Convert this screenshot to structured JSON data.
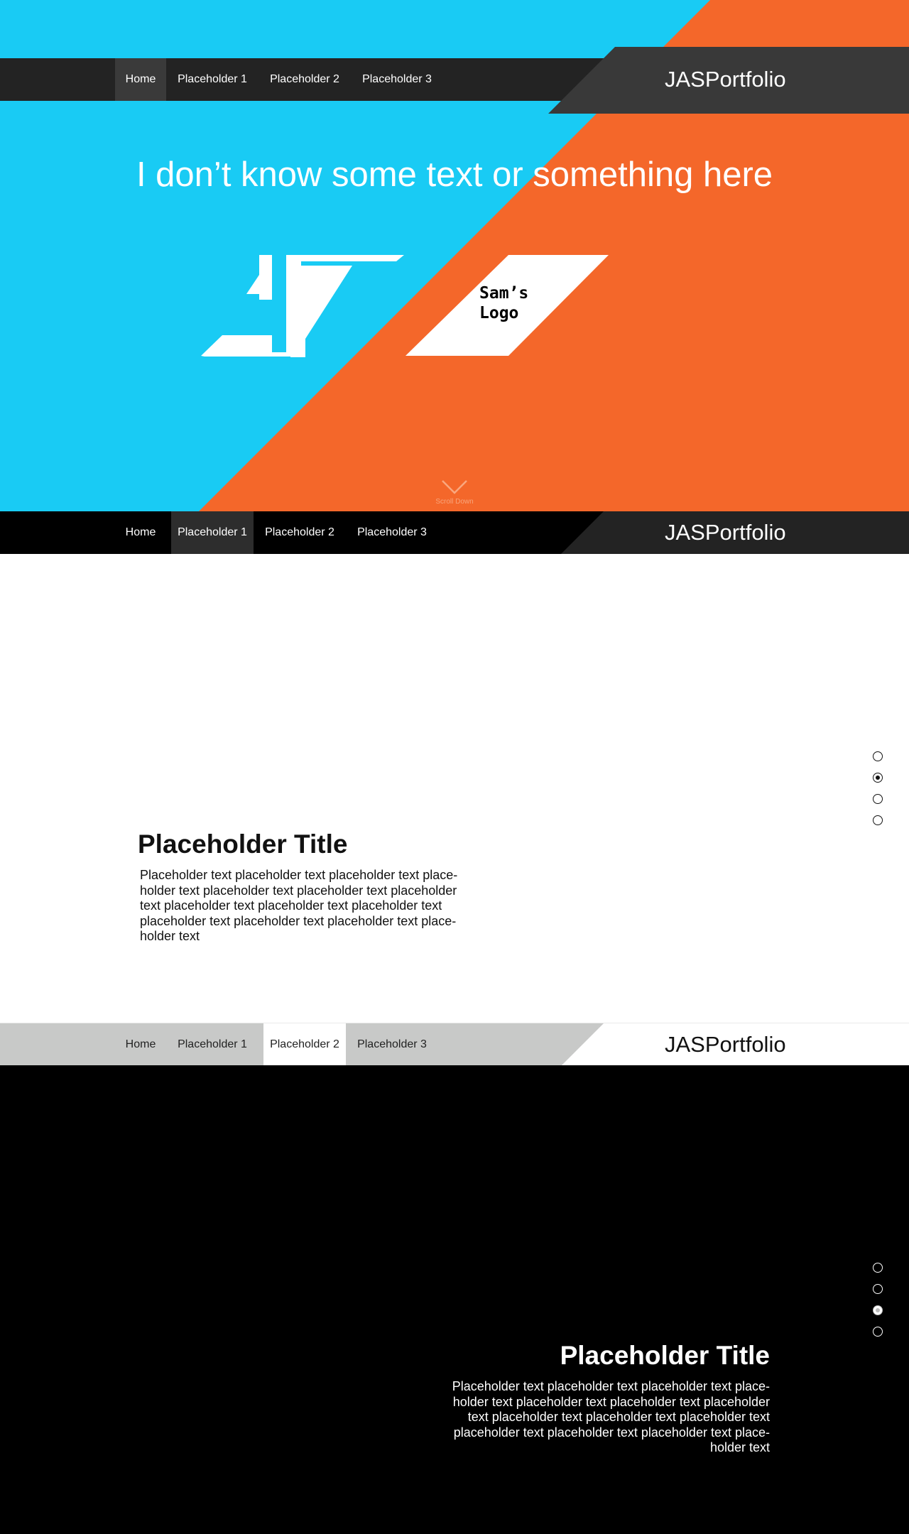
{
  "colors": {
    "hero_blue": "#19cbf4",
    "hero_orange": "#f4672a",
    "nav_dark": "#232323",
    "brand_panel": "#393939",
    "nav_light": "#c8c9c8"
  },
  "brand": "JASPortfolio",
  "nav_items": [
    "Home",
    "Placeholder 1",
    "Placeholder 2",
    "Placeholder 3"
  ],
  "hero": {
    "headline": "I don’t know some text or something here",
    "logo_jas": "jas-logo",
    "logo_sam_line1": "Sam’s",
    "logo_sam_line2": "Logo",
    "scroll_label": "Scroll Down"
  },
  "section_white": {
    "title": "Placeholder Title",
    "body": "Placeholder text placeholder text placeholder text place-holder text placeholder text placeholder text placeholder text placeholder text placeholder text placeholder text placeholder text placeholder text placeholder text place-holder text",
    "dots": 4,
    "active_dot": 1
  },
  "section_black": {
    "title": "Placeholder Title",
    "body": "Placeholder text placeholder text placeholder text place-holder text placeholder text placeholder text placeholder text placeholder text placeholder text placeholder text placeholder text placeholder text placeholder text place-holder text",
    "dots": 4,
    "active_dot": 2
  }
}
